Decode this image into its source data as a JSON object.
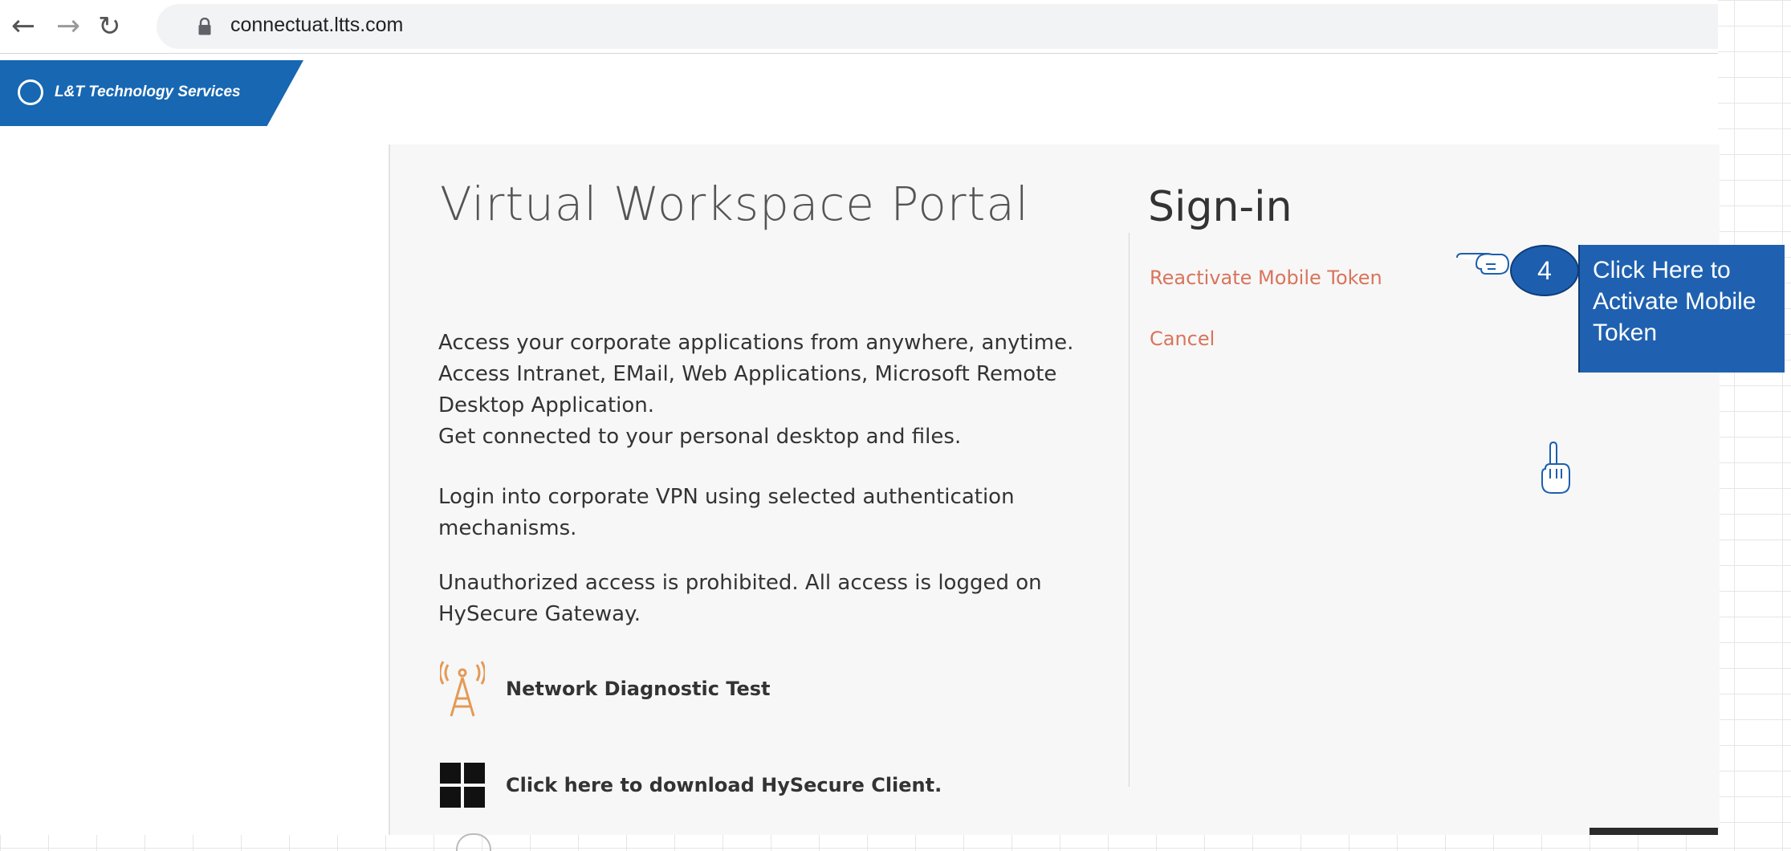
{
  "browser": {
    "url": "connectuat.ltts.com",
    "back_icon": "arrow-left-icon",
    "forward_icon": "arrow-right-icon",
    "reload_icon": "reload-icon",
    "lock_icon": "lock-icon"
  },
  "logo": {
    "text": "L&T Technology Services",
    "color": "#1767b2"
  },
  "portal": {
    "title": "Virtual Workspace Portal",
    "description_lines": [
      "Access your corporate applications from anywhere, anytime.",
      "Access Intranet, EMail, Web Applications, Microsoft Remote Desktop Application.",
      "Get connected to your personal desktop and files."
    ],
    "vpn_text": "Login into corporate VPN using selected authentication mechanisms.",
    "warning_text": "Unauthorized access is prohibited. All access is logged on HySecure Gateway.",
    "features": [
      {
        "icon": "antenna-icon",
        "label": "Network Diagnostic Test"
      },
      {
        "icon": "windows-icon",
        "label": "Click here to download HySecure Client."
      }
    ]
  },
  "signin": {
    "title": "Sign-in",
    "links": [
      "Reactivate Mobile Token",
      "Cancel"
    ],
    "link_color": "#d9745c"
  },
  "annotation": {
    "step_number": "4",
    "callout_text": "Click Here to Activate Mobile Token",
    "accent": "#1f61b0"
  }
}
